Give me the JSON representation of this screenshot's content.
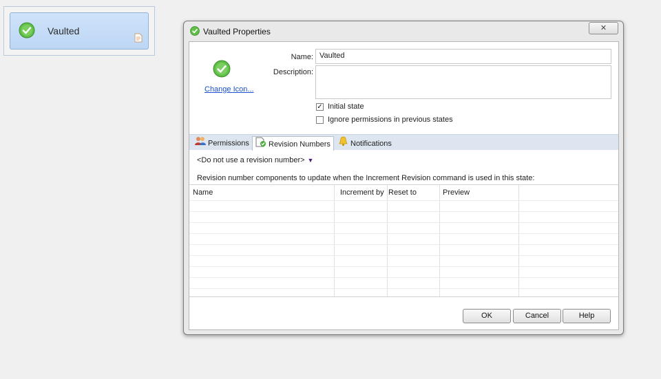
{
  "state_node": {
    "label": "Vaulted"
  },
  "dialog": {
    "title": "Vaulted Properties",
    "close_label": "✕",
    "change_icon_label": "Change Icon...",
    "name_label": "Name:",
    "name_value": "Vaulted",
    "description_label": "Description:",
    "description_value": "",
    "initial_state_label": "Initial state",
    "initial_state_checked": true,
    "ignore_permissions_label": "Ignore permissions in previous states",
    "ignore_permissions_checked": false,
    "tabs": [
      {
        "label": "Permissions",
        "active": false
      },
      {
        "label": "Revision Numbers",
        "active": true
      },
      {
        "label": "Notifications",
        "active": false
      }
    ],
    "revision_select_value": "<Do not use a revision number>",
    "revision_description": "Revision number components to update when the Increment Revision command is used in this state:",
    "grid": {
      "columns": [
        "Name",
        "Increment by",
        "Reset to",
        "Preview"
      ],
      "rows": []
    },
    "buttons": {
      "ok": "OK",
      "cancel": "Cancel",
      "help": "Help"
    }
  },
  "colors": {
    "check_green": "#4caf3c",
    "link_blue": "#1a4ecf",
    "node_blue": "#c4dcf7",
    "tabstrip": "#dde6f0"
  }
}
